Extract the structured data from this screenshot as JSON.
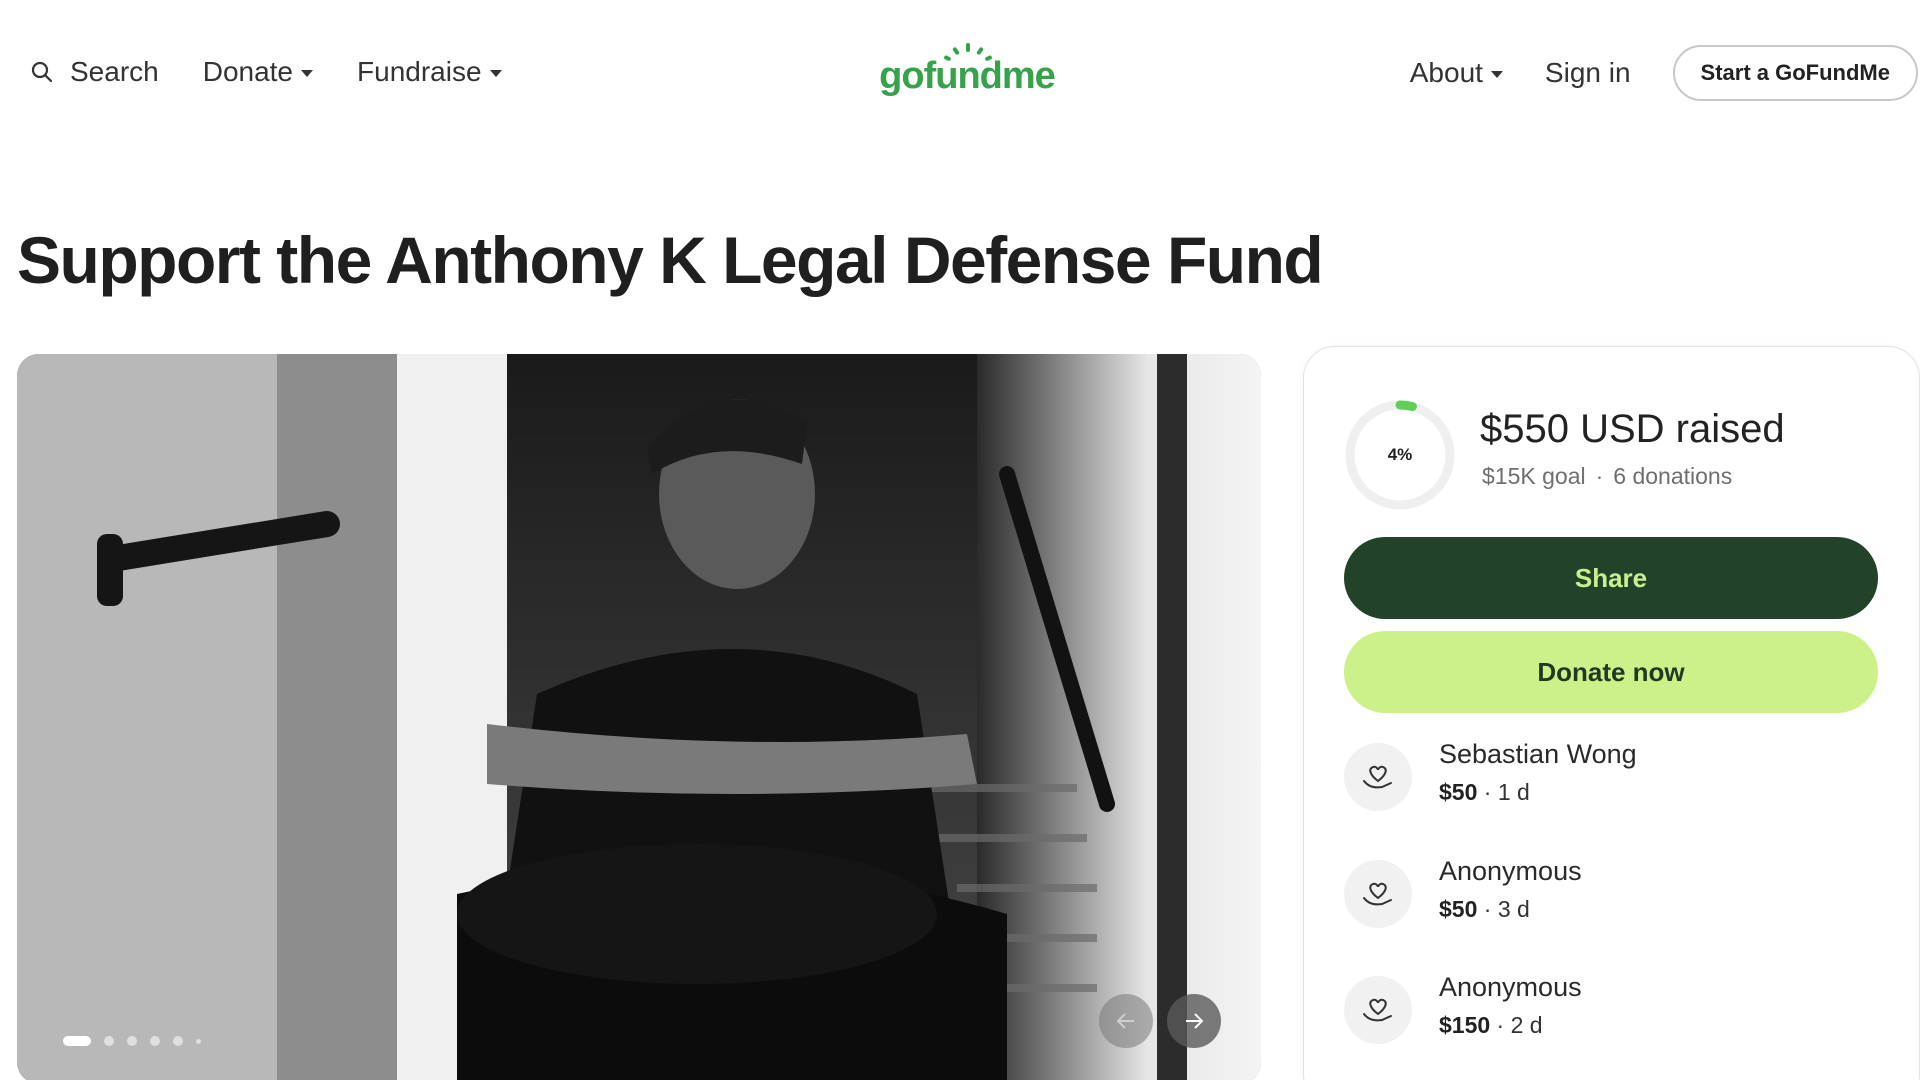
{
  "header": {
    "search_label": "Search",
    "donate_label": "Donate",
    "fundraise_label": "Fundraise",
    "logo_text": "gofundme",
    "about_label": "About",
    "signin_label": "Sign in",
    "start_label": "Start a GoFundMe"
  },
  "page": {
    "title": "Support the Anthony K Legal Defense Fund"
  },
  "gallery": {
    "slide_count": 6,
    "active_slide": 1
  },
  "campaign": {
    "progress_percent": 4,
    "progress_label": "4%",
    "raised_text": "$550 USD raised",
    "goal_text": "$15K goal",
    "donations_text": "6 donations",
    "share_label": "Share",
    "donate_label": "Donate now"
  },
  "donations": [
    {
      "name": "Sebastian Wong",
      "amount": "$50",
      "time": "1 d"
    },
    {
      "name": "Anonymous",
      "amount": "$50",
      "time": "3 d"
    },
    {
      "name": "Anonymous",
      "amount": "$150",
      "time": "2 d"
    }
  ],
  "colors": {
    "brand_green": "#36a34a",
    "share_bg": "#224229",
    "donate_bg": "#cdf189"
  }
}
